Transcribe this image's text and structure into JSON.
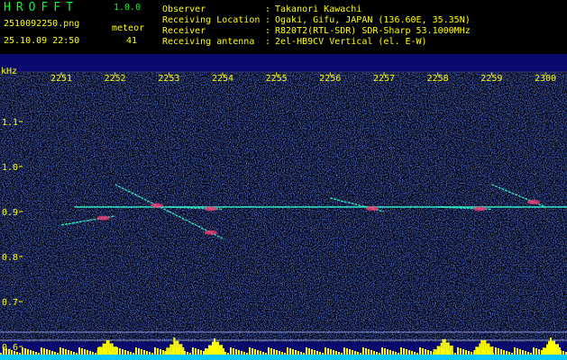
{
  "header": {
    "app_title": "HROFFT",
    "app_version": "1.0.0",
    "file_name": "2510092250.png",
    "timestamp": "25.10.09 22:50",
    "meteor_label": "meteor",
    "meteor_count": "41",
    "info": [
      {
        "key": "Observer",
        "value": "Takanori Kawachi"
      },
      {
        "key": "Receiving Location",
        "value": "Ogaki, Gifu, JAPAN (136.60E, 35.35N)"
      },
      {
        "key": "Receiver",
        "value": "R820T2(RTL-SDR) SDR-Sharp 53.1000MHz"
      },
      {
        "key": "Receiving antenna",
        "value": "2el-HB9CV Vertical (el. E-W)"
      }
    ],
    "separator": ":"
  },
  "colors": {
    "background": "#0a0a6e",
    "text_yellow": "#ffff00",
    "text_green": "#00ff2a",
    "signal_cyan": "#33ffd0",
    "signal_hot": "#ff3a7a",
    "level_bar": "#ffff00",
    "level_base": "#00c8ff"
  },
  "chart_data": {
    "type": "heatmap",
    "ylabel": "kHz",
    "x_ticks": [
      "2251",
      "2252",
      "2253",
      "2254",
      "2255",
      "2256",
      "2257",
      "2258",
      "2259",
      "2300"
    ],
    "y_ticks": [
      "1.1",
      "1.0",
      "0.9",
      "0.8",
      "0.7",
      "0.6"
    ],
    "ylim": [
      0.6,
      1.15
    ],
    "carrier_frequency_khz": 0.91,
    "meteor_traces": [
      {
        "x": [
          "2252",
          "2253"
        ],
        "y": [
          0.96,
          0.9
        ]
      },
      {
        "x": [
          "2253",
          "2254"
        ],
        "y": [
          0.9,
          0.84
        ]
      },
      {
        "x": [
          "2253",
          "2254"
        ],
        "y": [
          0.91,
          0.905
        ]
      },
      {
        "x": [
          "2256",
          "2257"
        ],
        "y": [
          0.93,
          0.9
        ]
      },
      {
        "x": [
          "2258",
          "2259"
        ],
        "y": [
          0.91,
          0.905
        ]
      },
      {
        "x": [
          "2259",
          "2300"
        ],
        "y": [
          0.96,
          0.91
        ]
      },
      {
        "x": [
          "2251",
          "2252"
        ],
        "y": [
          0.87,
          0.89
        ]
      }
    ],
    "level_bursts": [
      "2252",
      "2253",
      "2254",
      "2258",
      "2259",
      "2300"
    ]
  }
}
